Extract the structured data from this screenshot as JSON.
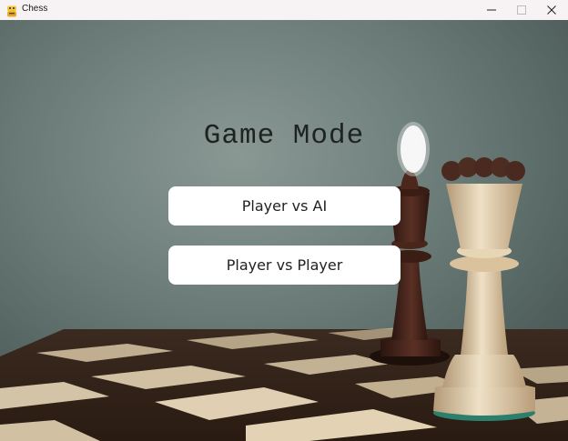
{
  "window": {
    "title": "Chess",
    "icon": "python-icon",
    "controls": {
      "minimize_icon": "minimize-icon",
      "maximize_icon": "maximize-icon",
      "close_icon": "close-icon"
    }
  },
  "menu": {
    "heading": "Game Mode",
    "buttons": [
      {
        "label": "Player vs AI"
      },
      {
        "label": "Player vs Player"
      }
    ]
  },
  "colors": {
    "background_wall": "#5d6f6c",
    "button_bg": "#ffffff",
    "heading_text": "#1e2322"
  }
}
